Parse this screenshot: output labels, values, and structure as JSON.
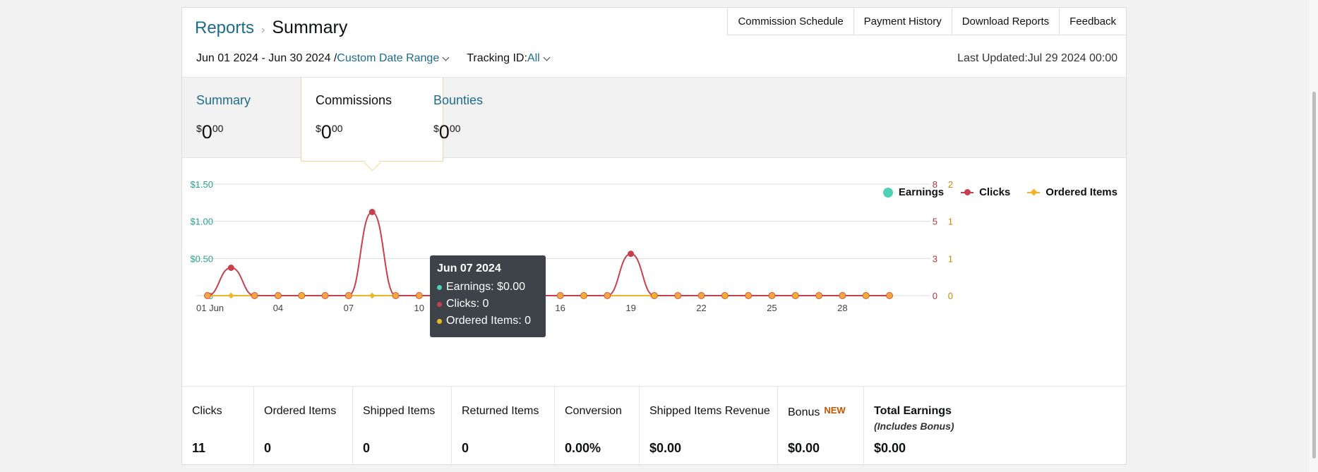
{
  "breadcrumb": {
    "reports": "Reports",
    "summary": "Summary"
  },
  "top_buttons": [
    "Commission Schedule",
    "Payment History",
    "Download Reports",
    "Feedback"
  ],
  "filters": {
    "date_range": "Jun 01 2024 - Jun 30 2024 /",
    "range_type": "Custom Date Range",
    "tracking_label": "Tracking ID:",
    "tracking_value": "All",
    "last_updated": "Last Updated:Jul 29 2024 00:00"
  },
  "tabs": [
    {
      "title": "Summary",
      "amount_sup": "$",
      "amount_main": "0",
      "amount_cents": "00"
    },
    {
      "title": "Commissions",
      "amount_sup": "$",
      "amount_main": "0",
      "amount_cents": "00"
    },
    {
      "title": "Bounties",
      "amount_sup": "$",
      "amount_main": "0",
      "amount_cents": "00"
    }
  ],
  "legend": [
    {
      "label": "Earnings",
      "color": "#4fd1b3"
    },
    {
      "label": "Clicks",
      "color": "#c8404e"
    },
    {
      "label": "Ordered Items",
      "color": "#f0b429"
    }
  ],
  "tooltip": {
    "date": "Jun 07 2024",
    "earnings": "Earnings: $0.00",
    "clicks": "Clicks: 0",
    "ordered": "Ordered Items: 0"
  },
  "chart_data": {
    "type": "line",
    "x": [
      "01 Jun",
      "02",
      "03",
      "04",
      "05",
      "06",
      "07",
      "08",
      "09",
      "10",
      "11",
      "12",
      "13",
      "14",
      "15",
      "16",
      "17",
      "18",
      "19",
      "20",
      "21",
      "22",
      "23",
      "24",
      "25",
      "26",
      "27",
      "28",
      "29",
      "30"
    ],
    "x_tick_labels": [
      "01 Jun",
      "04",
      "07",
      "10",
      "13",
      "16",
      "19",
      "22",
      "25",
      "28"
    ],
    "y_left_ticks": [
      "$1.50",
      "$1.00",
      "$0.50",
      "0"
    ],
    "y_right_clicks_ticks": [
      "8",
      "5",
      "3",
      "0"
    ],
    "y_right_items_ticks": [
      "2",
      "1",
      "1",
      "0"
    ],
    "ylim_left": [
      0,
      1.5
    ],
    "ylim_clicks": [
      0,
      8
    ],
    "series": [
      {
        "name": "Earnings",
        "color": "#4fd1b3",
        "values": [
          0,
          0,
          0,
          0,
          0,
          0,
          0,
          0,
          0,
          0,
          0,
          0,
          0,
          0,
          0,
          0,
          0,
          0,
          0,
          0,
          0,
          0,
          0,
          0,
          0,
          0,
          0,
          0,
          0,
          0
        ]
      },
      {
        "name": "Clicks",
        "color": "#c8404e",
        "values": [
          0,
          2,
          0,
          0,
          0,
          0,
          0,
          6,
          0,
          0,
          0,
          0,
          0,
          0,
          0,
          0,
          0,
          0,
          3,
          0,
          0,
          0,
          0,
          0,
          0,
          0,
          0,
          0,
          0,
          0
        ]
      },
      {
        "name": "Ordered Items",
        "color": "#f0b429",
        "values": [
          0,
          0,
          0,
          0,
          0,
          0,
          0,
          0,
          0,
          0,
          0,
          0,
          0,
          0,
          0,
          0,
          0,
          0,
          0,
          0,
          0,
          0,
          0,
          0,
          0,
          0,
          0,
          0,
          0,
          0
        ]
      }
    ]
  },
  "stats": [
    {
      "label": "Clicks",
      "value": "11"
    },
    {
      "label": "Ordered Items",
      "value": "0"
    },
    {
      "label": "Shipped Items",
      "value": "0"
    },
    {
      "label": "Returned Items",
      "value": "0"
    },
    {
      "label": "Conversion",
      "value": "0.00%"
    },
    {
      "label": "Shipped Items Revenue",
      "value": "$0.00"
    },
    {
      "label": "Bonus",
      "badge": "NEW",
      "value": "$0.00"
    },
    {
      "label": "Total Earnings",
      "sub": "(Includes Bonus)",
      "value": "$0.00"
    }
  ]
}
